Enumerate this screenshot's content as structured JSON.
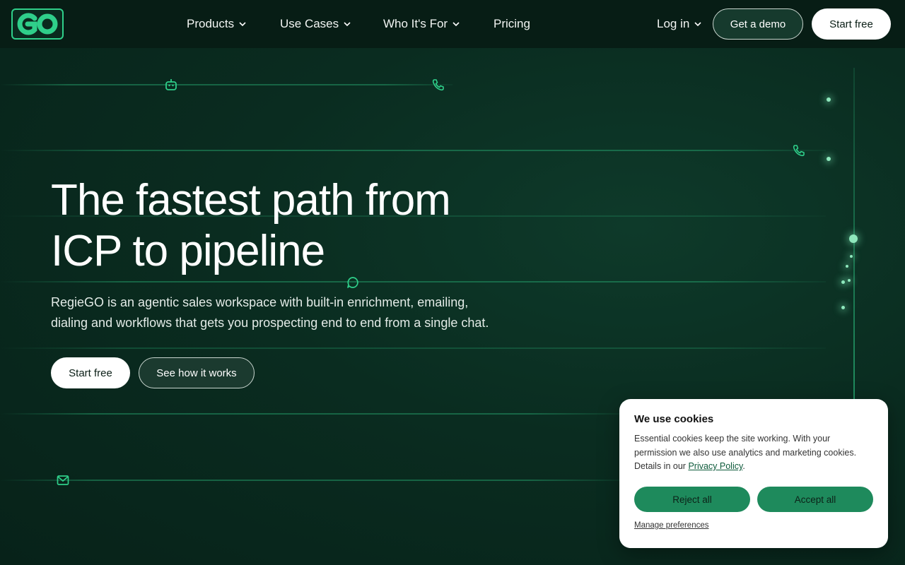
{
  "header": {
    "logo_icon": "regiego-go-logo",
    "nav": [
      {
        "label": "Products",
        "has_dropdown": true
      },
      {
        "label": "Use Cases",
        "has_dropdown": true
      },
      {
        "label": "Who It's For",
        "has_dropdown": true
      },
      {
        "label": "Pricing",
        "has_dropdown": false
      }
    ],
    "login_label": "Log in",
    "demo_label": "Get a demo",
    "start_label": "Start free"
  },
  "hero": {
    "title_line1": "The fastest path from",
    "title_line2": "ICP to pipeline",
    "subtitle_line1": "RegieGO is an agentic sales workspace with built-in enrichment, emailing,",
    "subtitle_line2": "dialing and workflows that gets you prospecting end to end from a single chat.",
    "cta_primary": "Start free",
    "cta_secondary": "See how it works"
  },
  "decor_icons": [
    "robot-icon",
    "phone-icon",
    "phone-icon",
    "chat-bubble-icon",
    "mail-icon"
  ],
  "cookie": {
    "title": "We use cookies",
    "text": "Essential cookies keep the site working. With your permission we also use analytics and marketing cookies. Details in our ",
    "link": "Privacy Policy",
    "after_link": ".",
    "reject_label": "Reject all",
    "accept_label": "Accept all",
    "manage_label": "Manage preferences"
  },
  "colors": {
    "background": "#0a2c20",
    "header": "#071d15",
    "accent": "#2fcf8a",
    "cookie_button": "#1e8a5c"
  }
}
